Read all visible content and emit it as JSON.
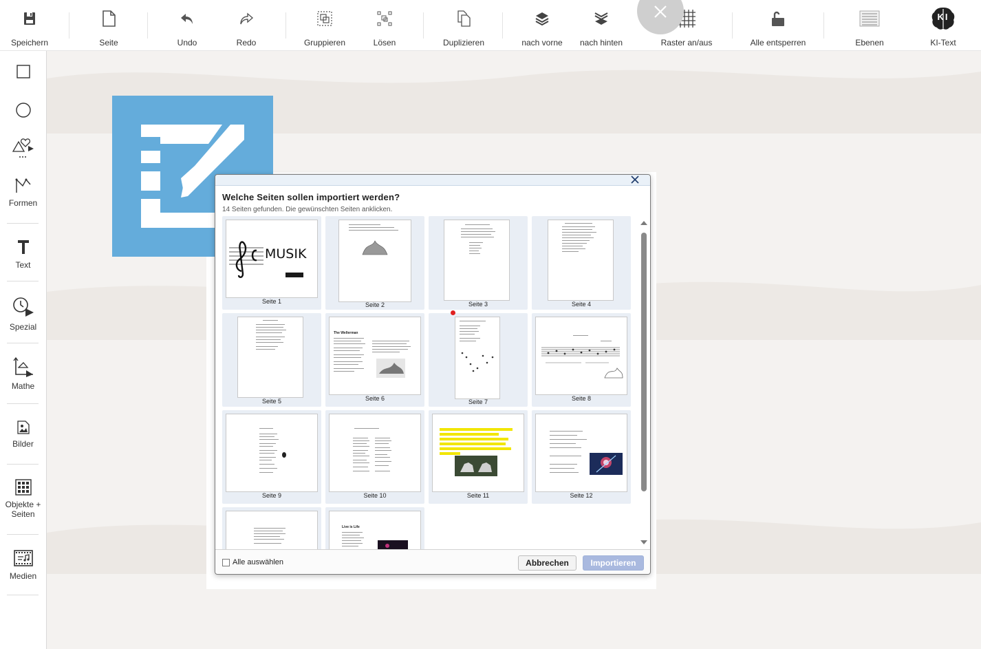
{
  "toolbar": {
    "items": [
      {
        "label": "Speichern",
        "icon": "save-icon"
      },
      {
        "label": "Seite",
        "icon": "page-icon"
      },
      {
        "label": "Undo",
        "icon": "undo-icon"
      },
      {
        "label": "Redo",
        "icon": "redo-icon"
      },
      {
        "label": "Gruppieren",
        "icon": "group-icon"
      },
      {
        "label": "Lösen",
        "icon": "ungroup-icon"
      },
      {
        "label": "Duplizieren",
        "icon": "duplicate-icon"
      },
      {
        "label": "nach vorne",
        "icon": "bring-forward-icon"
      },
      {
        "label": "nach hinten",
        "icon": "send-backward-icon"
      },
      {
        "label": "Raster an/aus",
        "icon": "grid-icon"
      },
      {
        "label": "Alle entsperren",
        "icon": "unlock-icon"
      },
      {
        "label": "Ebenen",
        "icon": "layers-icon"
      },
      {
        "label": "KI-Text",
        "icon": "ai-brain-icon",
        "badge": "KI"
      }
    ]
  },
  "sidebar": {
    "items": [
      {
        "label": "",
        "icon": "rectangle-icon"
      },
      {
        "label": "",
        "icon": "circle-icon"
      },
      {
        "label": "",
        "icon": "shapes-icon"
      },
      {
        "label": "Formen",
        "icon": "polyline-icon"
      },
      {
        "label": "Text",
        "icon": "text-icon"
      },
      {
        "label": "Spezial",
        "icon": "clock-play-icon"
      },
      {
        "label": "Mathe",
        "icon": "math-axes-icon"
      },
      {
        "label": "Bilder",
        "icon": "image-icon"
      },
      {
        "label": "Objekte + Seiten",
        "icon": "objects-grid-icon"
      },
      {
        "label": "Medien",
        "icon": "media-film-icon"
      }
    ]
  },
  "dialog": {
    "title": "Welche Seiten sollen importiert werden?",
    "subtitle": "14 Seiten gefunden. Die gewünschten Seiten anklicken.",
    "select_all_label": "Alle auswählen",
    "cancel_label": "Abbrechen",
    "import_label": "Importieren",
    "pages": [
      {
        "label": "Seite 1",
        "title_text": "MUSIK"
      },
      {
        "label": "Seite 2"
      },
      {
        "label": "Seite 3"
      },
      {
        "label": "Seite 4"
      },
      {
        "label": "Seite 5"
      },
      {
        "label": "Seite 6",
        "title_text": "The Wellerman"
      },
      {
        "label": "Seite 7"
      },
      {
        "label": "Seite 8"
      },
      {
        "label": "Seite 9"
      },
      {
        "label": "Seite 10"
      },
      {
        "label": "Seite 11"
      },
      {
        "label": "Seite 12"
      },
      {
        "label": ""
      },
      {
        "label": "",
        "title_text": "Live is Life"
      }
    ]
  },
  "colors": {
    "accent_blue": "#64acdb",
    "import_button": "#a9b9df",
    "thumb_bg": "#e9eef5",
    "highlight_yellow": "#f2e600"
  }
}
